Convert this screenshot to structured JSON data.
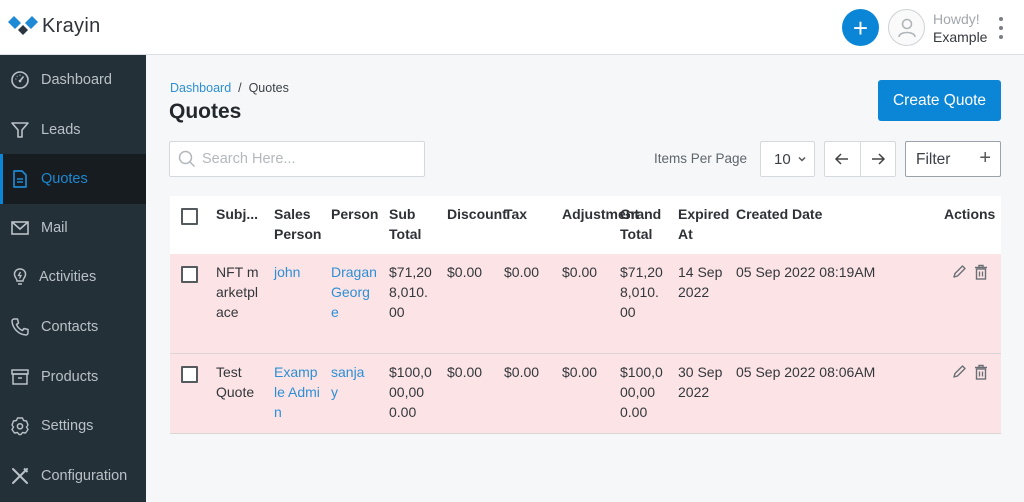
{
  "app": {
    "name": "Krayin"
  },
  "header": {
    "greeting": "Howdy!",
    "user_name": "Example"
  },
  "sidebar": {
    "items": [
      {
        "label": "Dashboard",
        "icon": "dashboard-gauge-icon",
        "active": false
      },
      {
        "label": "Leads",
        "icon": "filter-funnel-icon",
        "active": false
      },
      {
        "label": "Quotes",
        "icon": "document-icon",
        "active": true
      },
      {
        "label": "Mail",
        "icon": "envelope-icon",
        "active": false
      },
      {
        "label": "Activities",
        "icon": "lightbulb-icon",
        "active": false
      },
      {
        "label": "Contacts",
        "icon": "phone-icon",
        "active": false
      },
      {
        "label": "Products",
        "icon": "archive-box-icon",
        "active": false
      },
      {
        "label": "Settings",
        "icon": "gear-icon",
        "active": false
      },
      {
        "label": "Configuration",
        "icon": "tools-icon",
        "active": false
      }
    ]
  },
  "breadcrumb": {
    "parent": "Dashboard",
    "separator": "/",
    "current": "Quotes"
  },
  "page": {
    "title": "Quotes",
    "create_button": "Create Quote"
  },
  "toolbar": {
    "search_placeholder": "Search Here...",
    "search_value": "",
    "items_per_page_label": "Items Per Page",
    "items_per_page_value": "10",
    "filter_label": "Filter"
  },
  "table": {
    "columns": [
      "Subj...",
      "Sales Person",
      "Person",
      "Sub Total",
      "Discount",
      "Tax",
      "Adjustment",
      "Grand Total",
      "Expired At",
      "Created Date",
      "Actions"
    ],
    "rows": [
      {
        "subject": "NFT marketplace",
        "sales_person": "john",
        "person": "Dragan George",
        "sub_total": "$71,208,010.00",
        "discount": "$0.00",
        "tax": "$0.00",
        "adjustment": "$0.00",
        "grand_total": "$71,208,010.00",
        "expired_at": "14 Sep 2022",
        "created_date": "05 Sep 2022 08:19AM"
      },
      {
        "subject": "Test Quote",
        "sales_person": "Example Admin",
        "person": "sanjay",
        "sub_total": "$100,000,000.00",
        "discount": "$0.00",
        "tax": "$0.00",
        "adjustment": "$0.00",
        "grand_total": "$100,000,000.00",
        "expired_at": "30 Sep 2022",
        "created_date": "05 Sep 2022 08:06AM"
      }
    ]
  },
  "colors": {
    "accent": "#0b86d6",
    "sidebar_bg": "#243038",
    "sidebar_active_bg": "#171c21",
    "row_highlight": "#fce4e6",
    "link": "#2d8fd5"
  }
}
